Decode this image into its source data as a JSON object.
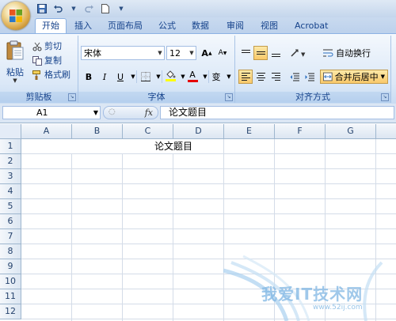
{
  "tabs": [
    "开始",
    "插入",
    "页面布局",
    "公式",
    "数据",
    "审阅",
    "视图",
    "Acrobat"
  ],
  "active_tab": "开始",
  "clipboard": {
    "paste_label": "粘贴",
    "cut_label": "剪切",
    "copy_label": "复制",
    "format_painter_label": "格式刷",
    "group_label": "剪贴板"
  },
  "font": {
    "font_name": "宋体",
    "font_size": "12",
    "bold": "B",
    "italic": "I",
    "underline": "U",
    "font_color_letter": "A",
    "grow_font": "A",
    "shrink_font": "A",
    "phonetic": "变",
    "group_label": "字体",
    "highlight_color": "#ffff00",
    "font_color": "#e60000"
  },
  "alignment": {
    "wrap_text_label": "自动换行",
    "merge_center_label": "合并后居中",
    "group_label": "对齐方式"
  },
  "formula_bar": {
    "name_box": "A1",
    "fx_label": "fx",
    "formula": "论文题目"
  },
  "sheet": {
    "columns": [
      "A",
      "B",
      "C",
      "D",
      "E",
      "F",
      "G"
    ],
    "rows": [
      "1",
      "2",
      "3",
      "4",
      "5",
      "6",
      "7",
      "8",
      "9",
      "10",
      "11",
      "12"
    ],
    "merged_cell_text": "论文题目"
  },
  "watermark": {
    "text": "我爱IT技术网",
    "url": "www.52ij.com"
  }
}
